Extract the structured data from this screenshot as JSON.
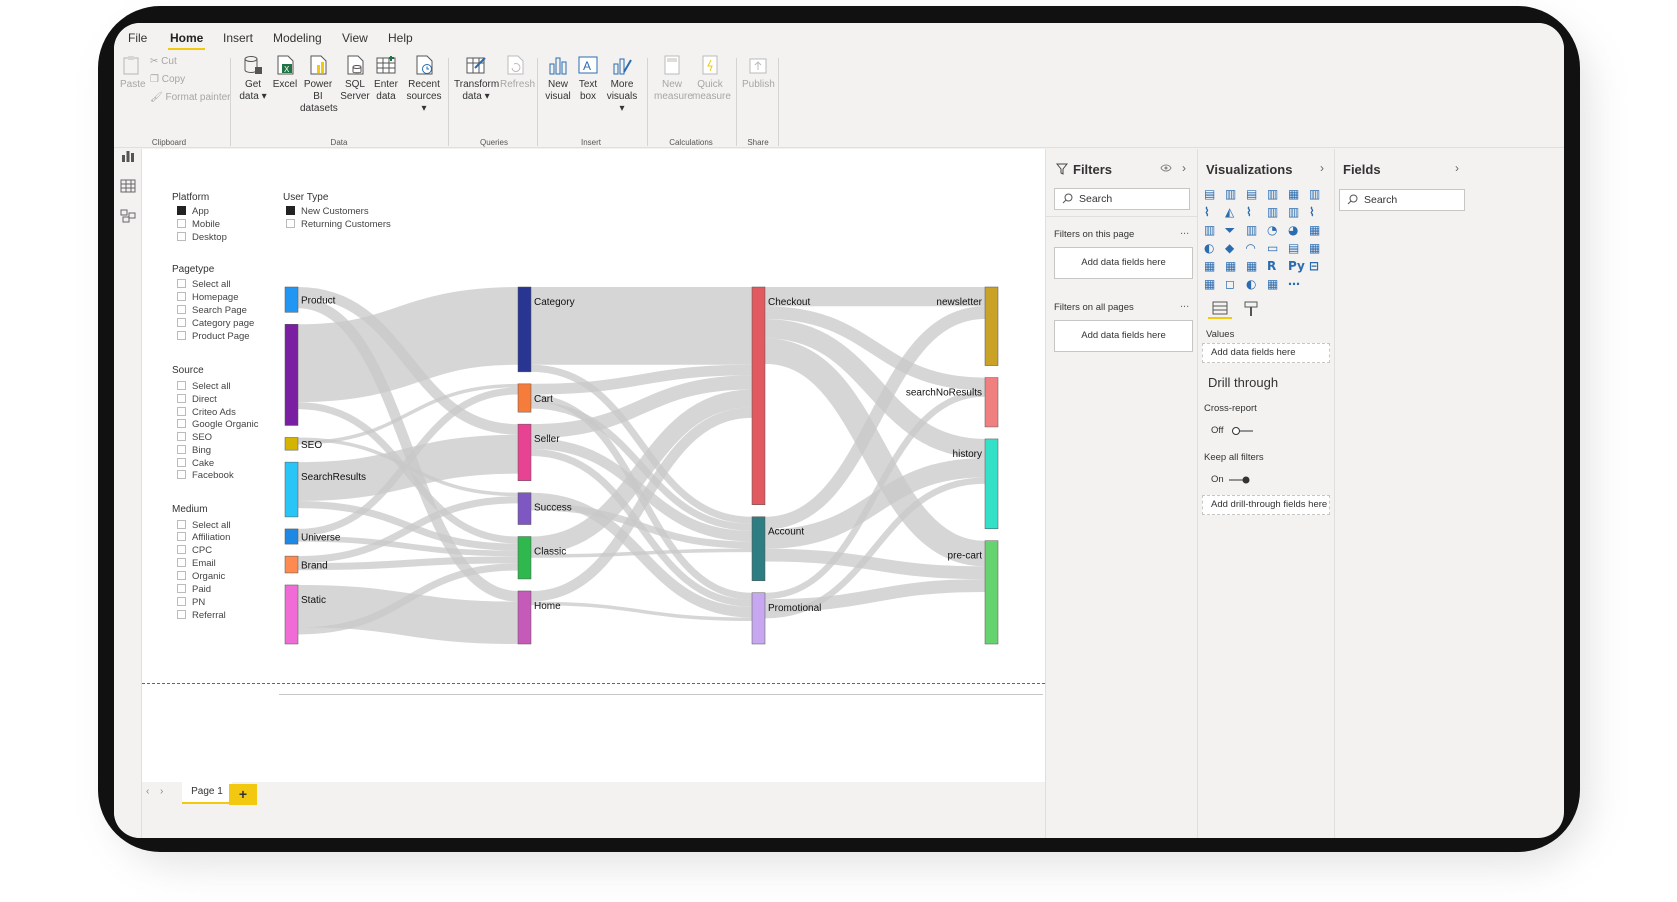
{
  "ribbon": {
    "tabs": [
      {
        "label": "File",
        "active": false
      },
      {
        "label": "Home",
        "active": true
      },
      {
        "label": "Insert",
        "active": false
      },
      {
        "label": "Modeling",
        "active": false
      },
      {
        "label": "View",
        "active": false
      },
      {
        "label": "Help",
        "active": false
      }
    ],
    "clipboard": {
      "paste": "Paste",
      "cut": "Cut",
      "copy": "Copy",
      "format_painter": "Format painter",
      "group": "Clipboard"
    },
    "data": {
      "get_data": [
        "Get",
        "data ▾"
      ],
      "excel": [
        "Excel"
      ],
      "power_bi": [
        "Power BI",
        "datasets"
      ],
      "sql": [
        "SQL",
        "Server"
      ],
      "enter": [
        "Enter",
        "data"
      ],
      "recent": [
        "Recent",
        "sources ▾"
      ],
      "group": "Data"
    },
    "queries": {
      "transform": [
        "Transform",
        "data ▾"
      ],
      "refresh": [
        "Refresh"
      ],
      "group": "Queries"
    },
    "insert": {
      "new_visual": [
        "New",
        "visual"
      ],
      "text_box": [
        "Text",
        "box"
      ],
      "more_visuals": [
        "More",
        "visuals ▾"
      ],
      "group": "Insert"
    },
    "calculations": {
      "new_measure": [
        "New",
        "measure"
      ],
      "quick_measure": [
        "Quick",
        "measure"
      ],
      "group": "Calculations"
    },
    "share": {
      "publish": [
        "Publish"
      ],
      "group": "Share"
    }
  },
  "slicers": {
    "platform": {
      "title": "Platform",
      "items": [
        {
          "label": "App",
          "checked": true
        },
        {
          "label": "Mobile",
          "checked": false
        },
        {
          "label": "Desktop",
          "checked": false
        }
      ]
    },
    "user_type": {
      "title": "User Type",
      "items": [
        {
          "label": "New Customers",
          "checked": true
        },
        {
          "label": "Returning Customers",
          "checked": false
        }
      ]
    },
    "pagetype": {
      "title": "Pagetype",
      "items": [
        "Select all",
        "Homepage",
        "Search Page",
        "Category page",
        "Product Page"
      ]
    },
    "source": {
      "title": "Source",
      "items": [
        "Select all",
        "Direct",
        "Criteo Ads",
        "Google Organic",
        "SEO",
        "Bing",
        "Cake",
        "Facebook"
      ]
    },
    "medium": {
      "title": "Medium",
      "items": [
        "Select all",
        "Affiliation",
        "CPC",
        "Email",
        "Organic",
        "Paid",
        "PN",
        "Referral"
      ]
    }
  },
  "chart_data": {
    "type": "sankey",
    "columns": [
      [
        {
          "name": "Product",
          "color": "#2196f3",
          "value": 3
        },
        {
          "name": "",
          "color": "#7b1fa2",
          "value": 12
        },
        {
          "name": "SEO",
          "color": "#d4b400",
          "value": 1.5
        },
        {
          "name": "SearchResults",
          "color": "#29c5f6",
          "value": 6.5
        },
        {
          "name": "Universe",
          "color": "#1e88e5",
          "value": 1.8
        },
        {
          "name": "Brand",
          "color": "#ff8a50",
          "value": 2
        },
        {
          "name": "Static",
          "color": "#f06bd6",
          "value": 7
        }
      ],
      [
        {
          "name": "Category",
          "color": "#283593",
          "value": 12
        },
        {
          "name": "Cart",
          "color": "#f57c3b",
          "value": 4
        },
        {
          "name": "Seller",
          "color": "#e84393",
          "value": 8
        },
        {
          "name": "Success",
          "color": "#7e57c2",
          "value": 4.5
        },
        {
          "name": "Classic",
          "color": "#2eb84e",
          "value": 6
        },
        {
          "name": "Home",
          "color": "#c65ab9",
          "value": 7.5
        }
      ],
      [
        {
          "name": "Checkout",
          "color": "#e05a60",
          "value": 17
        },
        {
          "name": "Account",
          "color": "#2e7d83",
          "value": 5
        },
        {
          "name": "Promotional",
          "color": "#c7a8f0",
          "value": 4
        }
      ],
      [
        {
          "name": "newsletter",
          "color": "#c9a227",
          "value": 3.5
        },
        {
          "name": "searchNoResults",
          "color": "#f08080",
          "value": 2.2
        },
        {
          "name": "history",
          "color": "#33e0c8",
          "value": 4
        },
        {
          "name": "pre-cart",
          "color": "#66d36e",
          "value": 4.6
        }
      ]
    ],
    "links": [
      {
        "from": [
          0,
          0
        ],
        "to": [
          1,
          2
        ],
        "value": 1.5
      },
      {
        "from": [
          0,
          0
        ],
        "to": [
          1,
          5
        ],
        "value": 1.5
      },
      {
        "from": [
          0,
          1
        ],
        "to": [
          1,
          0
        ],
        "value": 11
      },
      {
        "from": [
          0,
          1
        ],
        "to": [
          1,
          4
        ],
        "value": 1
      },
      {
        "from": [
          0,
          2
        ],
        "to": [
          1,
          3
        ],
        "value": 0.5
      },
      {
        "from": [
          0,
          2
        ],
        "to": [
          1,
          1
        ],
        "value": 0.5
      },
      {
        "from": [
          0,
          3
        ],
        "to": [
          1,
          2
        ],
        "value": 5.5
      },
      {
        "from": [
          0,
          3
        ],
        "to": [
          1,
          4
        ],
        "value": 1
      },
      {
        "from": [
          0,
          4
        ],
        "to": [
          1,
          1
        ],
        "value": 1
      },
      {
        "from": [
          0,
          4
        ],
        "to": [
          1,
          4
        ],
        "value": 0.8
      },
      {
        "from": [
          0,
          5
        ],
        "to": [
          1,
          3
        ],
        "value": 1
      },
      {
        "from": [
          0,
          5
        ],
        "to": [
          1,
          4
        ],
        "value": 1
      },
      {
        "from": [
          0,
          6
        ],
        "to": [
          1,
          5
        ],
        "value": 6
      },
      {
        "from": [
          0,
          6
        ],
        "to": [
          1,
          4
        ],
        "value": 1
      },
      {
        "from": [
          1,
          0
        ],
        "to": [
          2,
          0
        ],
        "value": 11
      },
      {
        "from": [
          1,
          0
        ],
        "to": [
          2,
          1
        ],
        "value": 1
      },
      {
        "from": [
          1,
          1
        ],
        "to": [
          2,
          0
        ],
        "value": 1.5
      },
      {
        "from": [
          1,
          1
        ],
        "to": [
          2,
          2
        ],
        "value": 1
      },
      {
        "from": [
          1,
          1
        ],
        "to": [
          2,
          1
        ],
        "value": 1
      },
      {
        "from": [
          1,
          2
        ],
        "to": [
          2,
          0
        ],
        "value": 2
      },
      {
        "from": [
          1,
          2
        ],
        "to": [
          2,
          1
        ],
        "value": 1.5
      },
      {
        "from": [
          1,
          2
        ],
        "to": [
          2,
          2
        ],
        "value": 1
      },
      {
        "from": [
          1,
          3
        ],
        "to": [
          2,
          2
        ],
        "value": 1.5
      },
      {
        "from": [
          1,
          3
        ],
        "to": [
          2,
          1
        ],
        "value": 1
      },
      {
        "from": [
          1,
          4
        ],
        "to": [
          2,
          0
        ],
        "value": 2.5
      },
      {
        "from": [
          1,
          4
        ],
        "to": [
          2,
          1
        ],
        "value": 0.5
      },
      {
        "from": [
          1,
          5
        ],
        "to": [
          2,
          0
        ],
        "value": 1.5
      },
      {
        "from": [
          1,
          5
        ],
        "to": [
          2,
          2
        ],
        "value": 0.5
      },
      {
        "from": [
          2,
          0
        ],
        "to": [
          3,
          0
        ],
        "value": 1.5
      },
      {
        "from": [
          2,
          0
        ],
        "to": [
          3,
          1
        ],
        "value": 1
      },
      {
        "from": [
          2,
          0
        ],
        "to": [
          3,
          2
        ],
        "value": 1.5
      },
      {
        "from": [
          2,
          0
        ],
        "to": [
          3,
          3
        ],
        "value": 2
      },
      {
        "from": [
          2,
          1
        ],
        "to": [
          3,
          0
        ],
        "value": 1
      },
      {
        "from": [
          2,
          1
        ],
        "to": [
          3,
          2
        ],
        "value": 1.5
      },
      {
        "from": [
          2,
          1
        ],
        "to": [
          3,
          3
        ],
        "value": 1
      },
      {
        "from": [
          2,
          2
        ],
        "to": [
          3,
          1
        ],
        "value": 0.5
      },
      {
        "from": [
          2,
          2
        ],
        "to": [
          3,
          3
        ],
        "value": 1
      },
      {
        "from": [
          2,
          2
        ],
        "to": [
          3,
          2
        ],
        "value": 0.5
      }
    ]
  },
  "filters": {
    "title": "Filters",
    "search_placeholder": "Search",
    "on_this_page": "Filters on this page",
    "on_all_pages": "Filters on all pages",
    "add_fields": "Add data fields here",
    "dots": "..."
  },
  "visualizations": {
    "title": "Visualizations",
    "values_label": "Values",
    "add_fields": "Add data fields here",
    "drill_through": "Drill through",
    "cross_report": "Cross-report",
    "cross_report_state": "Off",
    "keep_all_filters": "Keep all filters",
    "keep_all_filters_state": "On",
    "add_drill_fields": "Add drill-through fields here"
  },
  "fields": {
    "title": "Fields",
    "search_placeholder": "Search"
  },
  "pages": {
    "tabs": [
      "Page 1"
    ],
    "add": "+"
  },
  "colors": {
    "accent": "#f2c811",
    "ribbon_bg": "#f3f2f1",
    "link": "#c8c8c8"
  }
}
